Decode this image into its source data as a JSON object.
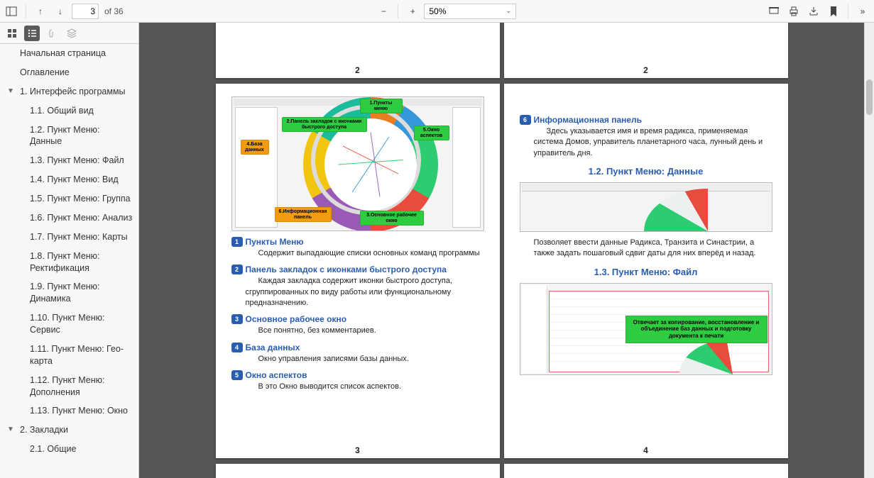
{
  "toolbar": {
    "page_current": "3",
    "page_of": "of 36",
    "zoom": "50%"
  },
  "outline": {
    "items": [
      {
        "level": 1,
        "expand": "",
        "label": "Начальная страница"
      },
      {
        "level": 1,
        "expand": "",
        "label": "Оглавление"
      },
      {
        "level": 1,
        "expand": "▼",
        "label": "1. Интерфейс программы"
      },
      {
        "level": 2,
        "label": "1.1. Общий вид"
      },
      {
        "level": 2,
        "label": "1.2. Пункт Меню: Данные"
      },
      {
        "level": 2,
        "label": "1.3. Пункт Меню: Файл"
      },
      {
        "level": 2,
        "label": "1.4. Пункт Меню: Вид"
      },
      {
        "level": 2,
        "label": "1.5. Пункт Меню: Группа"
      },
      {
        "level": 2,
        "label": "1.6. Пункт Меню: Анализ"
      },
      {
        "level": 2,
        "label": "1.7. Пункт Меню: Карты"
      },
      {
        "level": 2,
        "label": "1.8. Пункт Меню: Ректификация"
      },
      {
        "level": 2,
        "label": "1.9. Пункт Меню: Динамика"
      },
      {
        "level": 2,
        "label": "1.10. Пункт Меню: Сервис"
      },
      {
        "level": 2,
        "label": "1.11. Пункт Меню: Гео-карта"
      },
      {
        "level": 2,
        "label": "1.12. Пункт Меню: Дополнения"
      },
      {
        "level": 2,
        "label": "1.13. Пункт Меню: Окно"
      },
      {
        "level": 1,
        "expand": "▼",
        "label": "2. Закладки"
      },
      {
        "level": 2,
        "label": "2.1. Общие"
      }
    ]
  },
  "page2": {
    "num": "2"
  },
  "page3": {
    "num": "3",
    "callouts": {
      "c1": "1.Пункты меню",
      "c2": "2.Панель закладок с иконками быстрого доступа",
      "c3": "3.Основное рабочее окно",
      "c4": "4.База данных",
      "c5": "5.Окно аспектов",
      "c6": "6.Информационная панель"
    },
    "s1": {
      "n": "1",
      "t": "Пункты Меню",
      "b": "Содержит выпадающие списки основных команд программы"
    },
    "s2": {
      "n": "2",
      "t": "Панель закладок с иконками быстрого доступа",
      "b": "Каждая закладка содержит иконки быстрого доступа, сгруппированных по виду работы или функциональному предназначению."
    },
    "s3": {
      "n": "3",
      "t": "Основное рабочее окно",
      "b": "Все понятно, без комментариев."
    },
    "s4": {
      "n": "4",
      "t": "База данных",
      "b": "Окно управления записями базы данных."
    },
    "s5": {
      "n": "5",
      "t": "Окно аспектов",
      "b": "В это Окно выводится список аспектов."
    }
  },
  "page4": {
    "num": "4",
    "s6": {
      "n": "6",
      "t": "Информационная панель",
      "b": "Здесь указывается имя и время радикса, применяемая система Домов, управитель планетарного часа, лунный день и управитель дня."
    },
    "h12": "1.2. Пункт Меню: Данные",
    "b12": "Позволяет ввести данные Радикса, Транзита и Синастрии, а также задать пошаговый сдвиг даты для них вперёд и назад.",
    "h13": "1.3. Пункт Меню: Файл",
    "callout13": "Отвечает за копирование, восстановление и объединение баз данных и подготовку документа к печати"
  }
}
